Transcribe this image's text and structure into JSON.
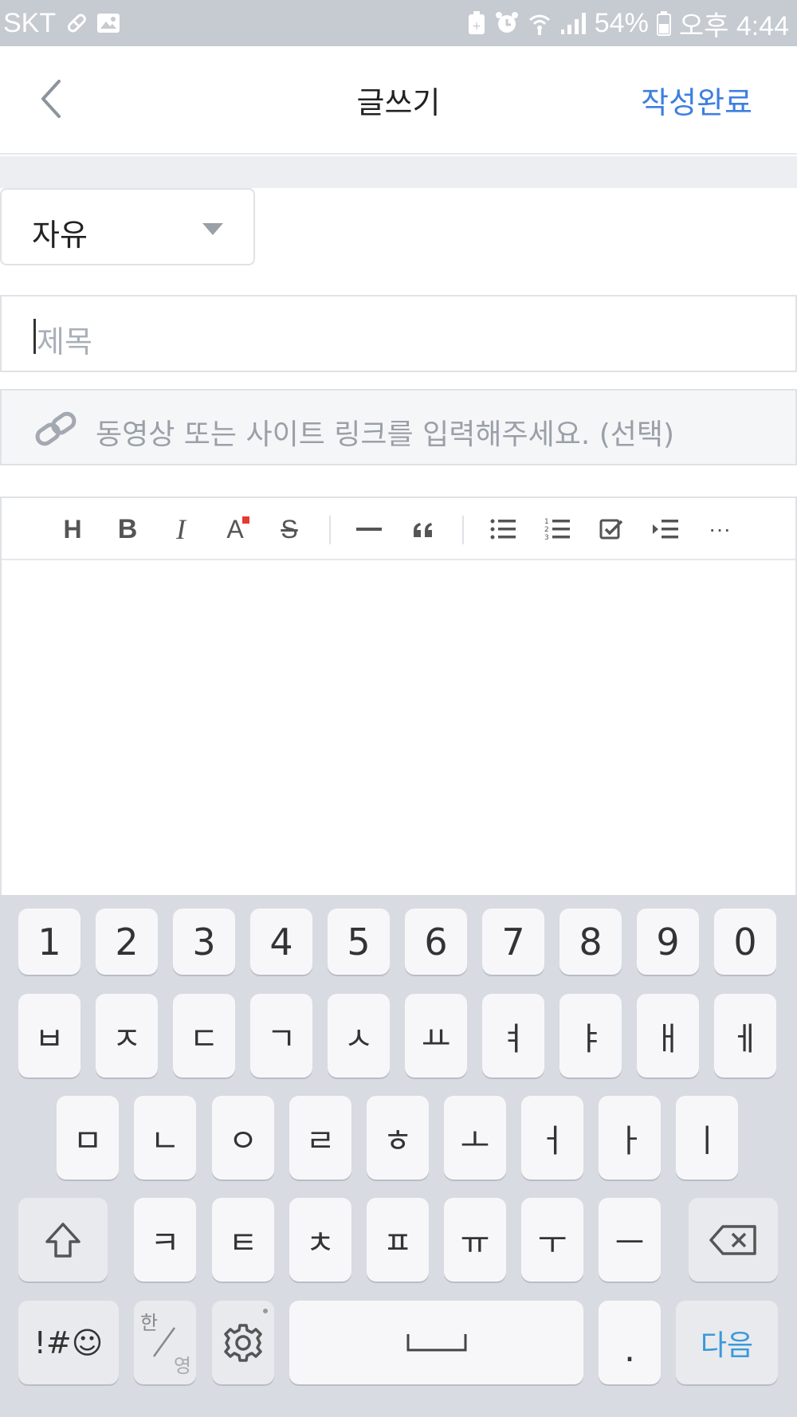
{
  "status_bar": {
    "carrier": "SKT",
    "battery_percent": "54%",
    "time": "오후 4:44"
  },
  "header": {
    "title": "글쓰기",
    "done_label": "작성완료"
  },
  "form": {
    "category": {
      "selected": "자유"
    },
    "title": {
      "placeholder": "제목"
    },
    "link": {
      "placeholder": "동영상 또는 사이트 링크를 입력해주세요. (선택)"
    }
  },
  "toolbar": {
    "heading": "H",
    "bold": "B",
    "italic": "I",
    "font_color": "A",
    "strike": "S",
    "more": "···"
  },
  "keyboard": {
    "row_numbers": [
      "1",
      "2",
      "3",
      "4",
      "5",
      "6",
      "7",
      "8",
      "9",
      "0"
    ],
    "row1": [
      "ㅂ",
      "ㅈ",
      "ㄷ",
      "ㄱ",
      "ㅅ",
      "ㅛ",
      "ㅕ",
      "ㅑ",
      "ㅐ",
      "ㅔ"
    ],
    "row2": [
      "ㅁ",
      "ㄴ",
      "ㅇ",
      "ㄹ",
      "ㅎ",
      "ㅗ",
      "ㅓ",
      "ㅏ",
      "ㅣ"
    ],
    "row3": [
      "ㅋ",
      "ㅌ",
      "ㅊ",
      "ㅍ",
      "ㅠ",
      "ㅜ",
      "ㅡ"
    ],
    "symbols_label": "!#☺",
    "lang_top": "한",
    "lang_bottom": "영",
    "period_label": ".",
    "next_label": "다음"
  },
  "colors": {
    "accent": "#3d7fe0",
    "status_bar_bg": "#c6cad1",
    "keyboard_bg": "#d8dbe1",
    "font_color_marker": "#e53935",
    "next_key": "#3a9ad9"
  }
}
